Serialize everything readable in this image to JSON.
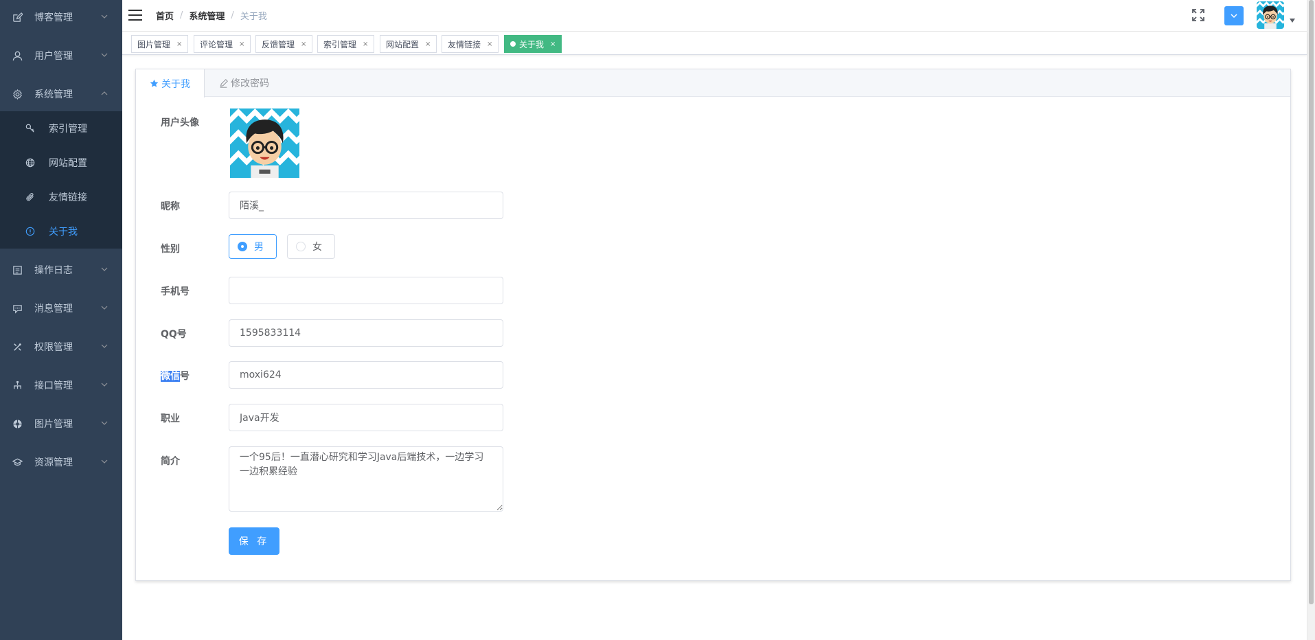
{
  "sidebar": {
    "menus": [
      {
        "label": "博客管理",
        "icon": "edit-icon",
        "expanded": false
      },
      {
        "label": "用户管理",
        "icon": "user-icon",
        "expanded": false
      },
      {
        "label": "系统管理",
        "icon": "gear-icon",
        "expanded": true
      },
      {
        "label": "操作日志",
        "icon": "document-icon",
        "expanded": false
      },
      {
        "label": "消息管理",
        "icon": "message-icon",
        "expanded": false
      },
      {
        "label": "权限管理",
        "icon": "tools-icon",
        "expanded": false
      },
      {
        "label": "接口管理",
        "icon": "hierarchy-icon",
        "expanded": false
      },
      {
        "label": "图片管理",
        "icon": "picture-icon",
        "expanded": false
      },
      {
        "label": "资源管理",
        "icon": "graduation-cap-icon",
        "expanded": false
      }
    ],
    "submenu": [
      {
        "label": "索引管理",
        "icon": "key-icon",
        "active": false
      },
      {
        "label": "网站配置",
        "icon": "globe-icon",
        "active": false
      },
      {
        "label": "友情链接",
        "icon": "paperclip-icon",
        "active": false
      },
      {
        "label": "关于我",
        "icon": "info-icon",
        "active": true
      }
    ]
  },
  "navbar": {
    "breadcrumb": [
      "首页",
      "系统管理",
      "关于我"
    ]
  },
  "tags": [
    {
      "label": "图片管理",
      "active": false
    },
    {
      "label": "评论管理",
      "active": false
    },
    {
      "label": "反馈管理",
      "active": false
    },
    {
      "label": "索引管理",
      "active": false
    },
    {
      "label": "网站配置",
      "active": false
    },
    {
      "label": "友情链接",
      "active": false
    },
    {
      "label": "关于我",
      "active": true
    }
  ],
  "tag_close": "×",
  "card_tabs": {
    "about": "关于我",
    "password": "修改密码"
  },
  "form": {
    "avatar_label": "用户头像",
    "nickname_label": "昵称",
    "nickname": "陌溪_",
    "gender_label": "性别",
    "gender_male": "男",
    "gender_female": "女",
    "phone_label": "手机号",
    "phone": "",
    "qq_label": "QQ号",
    "qq": "1595833114",
    "wechat_label_highlight": "微信",
    "wechat_label_rest": "号",
    "wechat": "moxi624",
    "job_label": "职业",
    "job": "Java开发",
    "summary_label": "简介",
    "summary": "一个95后！一直潜心研究和学习Java后端技术，一边学习一边积累经验",
    "save": "保 存"
  },
  "colors": {
    "sidebar_bg": "#304156",
    "submenu_bg": "#1f2d3d",
    "primary": "#409eff",
    "tag_active": "#42b983"
  }
}
